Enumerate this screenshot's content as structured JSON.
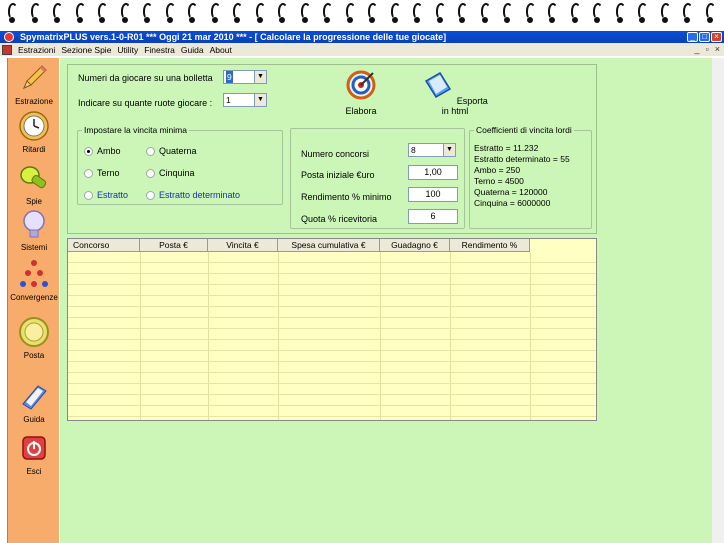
{
  "window": {
    "title": "SpymatrixPLUS vers.1-0-R01  ***  Oggi 21 mar 2010  ***  - [ Calcolare la progressione delle tue giocate]"
  },
  "menu": [
    "Estrazioni",
    "Sezione Spie",
    "Utility",
    "Finestra",
    "Guida",
    "About"
  ],
  "sidebar": [
    {
      "label": "Estrazione",
      "icon": "pencil-icon"
    },
    {
      "label": "Ritardi",
      "icon": "clock-icon"
    },
    {
      "label": "Spie",
      "icon": "flashlight-icon"
    },
    {
      "label": "Sistemi",
      "icon": "lightbulb-icon"
    },
    {
      "label": "Convergenze",
      "icon": "convergence-icon"
    },
    {
      "label": "Posta",
      "icon": "coin-icon"
    },
    {
      "label": "Guida",
      "icon": "book-icon"
    },
    {
      "label": "Esci",
      "icon": "exit-icon"
    }
  ],
  "form": {
    "numeri_label": "Numeri da giocare su una bolletta",
    "numeri_value": "9",
    "ruote_label": "Indicare su quante ruote giocare :",
    "ruote_value": "1"
  },
  "actions": {
    "elabora": "Elabora",
    "esporta": "Esporta in html"
  },
  "vincita": {
    "legend": "Impostare la vincita minima",
    "options": [
      "Ambo",
      "Quaterna",
      "Terno",
      "Cinquina",
      "Estratto",
      "Estratto determinato"
    ],
    "selected": "Ambo"
  },
  "params": {
    "concorsi_label": "Numero concorsi",
    "concorsi_value": "8",
    "posta_label": "Posta iniziale €uro",
    "posta_value": "1,00",
    "rendimento_label": "Rendimento % minimo",
    "rendimento_value": "100",
    "quota_label": "Quota % ricevitoria",
    "quota_value": "6"
  },
  "coefficienti": {
    "legend": "Coefficienti di vincita lordi",
    "lines": [
      "Estratto =  11.232",
      "Estratto determinato =  55",
      "Ambo =  250",
      "Terno =  4500",
      "Quaterna =  120000",
      "Cinquina =  6000000"
    ]
  },
  "table": {
    "columns": [
      "Concorso",
      "Posta €",
      "Vincita €",
      "Spesa cumulativa €",
      "Guadagno €",
      "Rendimento %"
    ]
  },
  "colors": {
    "background": "#ccf5b8",
    "sidebar": "#f8ac6c",
    "grid": "#ffffc4",
    "titlebar": "#0a4fd6"
  }
}
